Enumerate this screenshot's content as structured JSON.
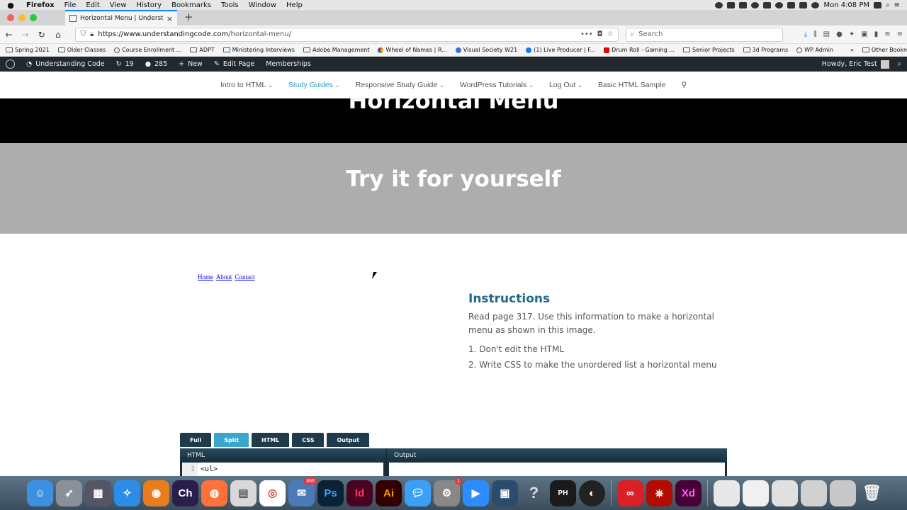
{
  "mac_menu": {
    "app": "Firefox",
    "items": [
      "File",
      "Edit",
      "View",
      "History",
      "Bookmarks",
      "Tools",
      "Window",
      "Help"
    ],
    "clock": "Mon 4:08 PM"
  },
  "browser": {
    "tab_title": "Horizontal Menu | Understandin",
    "url_host": "https://www.understandingcode.com",
    "url_path": "/horizontal-menu/",
    "search_placeholder": "Search"
  },
  "bookmarks": [
    {
      "label": "Spring 2021",
      "icon": "folder"
    },
    {
      "label": "Older Classes",
      "icon": "folder"
    },
    {
      "label": "Course Enrollment ...",
      "icon": "globe"
    },
    {
      "label": "ADPT",
      "icon": "folder"
    },
    {
      "label": "Ministering Interviews",
      "icon": "folder"
    },
    {
      "label": "Adobe Management",
      "icon": "folder"
    },
    {
      "label": "Wheel of Names | R...",
      "icon": "wheel"
    },
    {
      "label": "Visual Society W21",
      "icon": "c-circle"
    },
    {
      "label": "(1) Live Producer | F...",
      "icon": "facebook"
    },
    {
      "label": "Drum Roll - Gaming ...",
      "icon": "video"
    },
    {
      "label": "Senior Projects",
      "icon": "folder"
    },
    {
      "label": "3d Programs",
      "icon": "folder"
    },
    {
      "label": "WP Admin",
      "icon": "globe"
    }
  ],
  "other_bookmarks": "Other Bookmarks",
  "wp_admin": {
    "site_name": "Understanding Code",
    "updates": "19",
    "comments": "285",
    "new_label": "New",
    "edit_label": "Edit Page",
    "memberships": "Memberships",
    "howdy": "Howdy, Eric Test"
  },
  "site_nav": [
    {
      "label": "Intro to HTML",
      "dropdown": true,
      "active": false
    },
    {
      "label": "Study Guides",
      "dropdown": true,
      "active": true
    },
    {
      "label": "Responsive Study Guide",
      "dropdown": true,
      "active": false
    },
    {
      "label": "WordPress Tutorials",
      "dropdown": true,
      "active": false
    },
    {
      "label": "Log Out",
      "dropdown": true,
      "active": false
    },
    {
      "label": "Basic HTML Sample",
      "dropdown": false,
      "active": false
    }
  ],
  "hero": {
    "title": "Horizontal Menu",
    "subtitle": "Try it for yourself"
  },
  "sample_menu": [
    "Home",
    "About",
    "Contact"
  ],
  "instructions": {
    "heading": "Instructions",
    "body": "Read page 317. Use this information to make a horizontal menu as shown in this image.",
    "steps": [
      "1. Don't edit the HTML",
      "2. Write CSS to make the unordered list a horizontal menu"
    ]
  },
  "editor": {
    "tabs": [
      "Full",
      "Split",
      "HTML",
      "CSS",
      "Output"
    ],
    "active_tab": "Split",
    "html_label": "HTML",
    "output_label": "Output",
    "line_number": "1",
    "first_line": "<ul>"
  },
  "colors": {
    "accent": "#2e9fc4",
    "instructions_heading": "#1f6a8a",
    "hero_dark": "#000000",
    "hero_gray": "#adadad"
  }
}
